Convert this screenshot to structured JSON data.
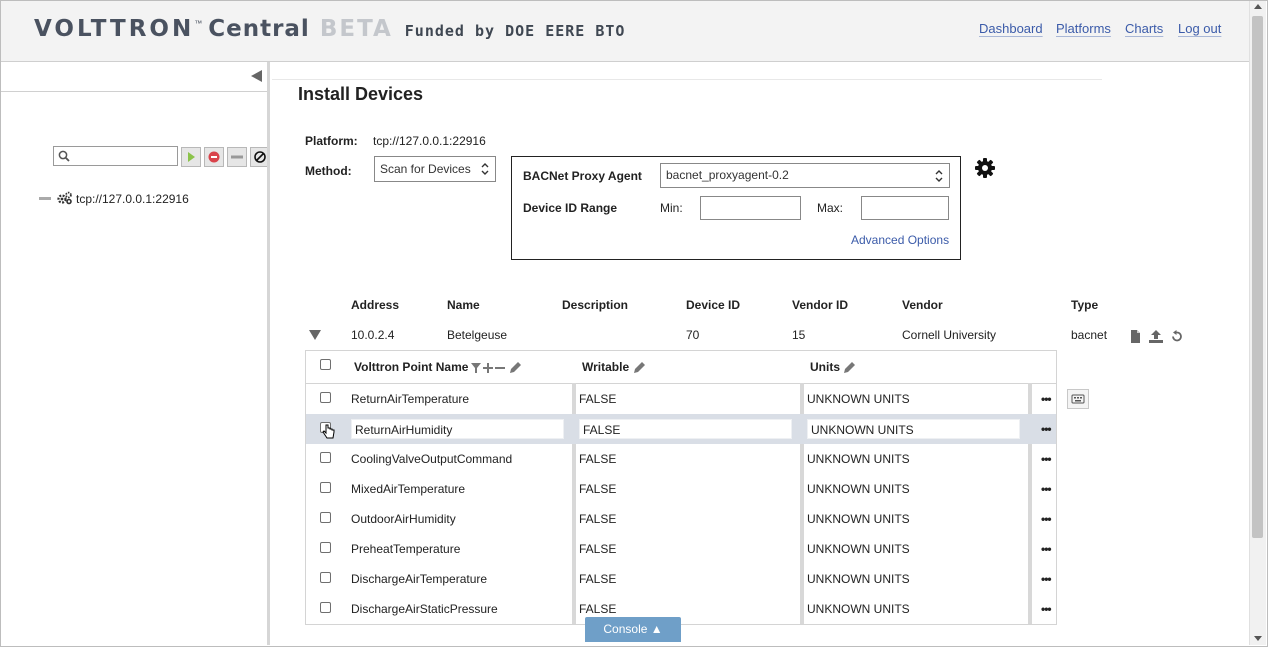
{
  "header": {
    "logo_volttron": "VOLTTRON",
    "logo_tm": "™",
    "logo_central": "Central",
    "logo_beta": "BETA",
    "logo_funded": "Funded by DOE EERE BTO",
    "nav": [
      "Dashboard",
      "Platforms",
      "Charts",
      "Log out"
    ]
  },
  "sidebar": {
    "search_placeholder": "",
    "platform_label": "tcp://127.0.0.1:22916"
  },
  "main": {
    "title": "Install Devices",
    "platform_label": "Platform:",
    "platform_value": "tcp://127.0.0.1:22916",
    "method_label": "Method:",
    "method_value": "Scan for Devices",
    "proxy_label": "BACNet Proxy Agent",
    "proxy_value": "bacnet_proxyagent-0.2",
    "range_label": "Device ID Range",
    "min_label": "Min:",
    "max_label": "Max:",
    "min_value": "",
    "max_value": "",
    "advanced_label": "Advanced Options"
  },
  "devices": {
    "columns": [
      "Address",
      "Name",
      "Description",
      "Device ID",
      "Vendor ID",
      "Vendor",
      "Type"
    ],
    "rows": [
      {
        "address": "10.0.2.4",
        "name": "Betelgeuse",
        "description": "",
        "device_id": "70",
        "vendor_id": "15",
        "vendor": "Cornell University",
        "type": "bacnet"
      }
    ]
  },
  "points": {
    "headers": {
      "name": "Volttron Point Name",
      "writable": "Writable",
      "units": "Units"
    },
    "rows": [
      {
        "name": "ReturnAirTemperature",
        "writable": "FALSE",
        "units": "UNKNOWN UNITS"
      },
      {
        "name": "ReturnAirHumidity",
        "writable": "FALSE",
        "units": "UNKNOWN UNITS"
      },
      {
        "name": "CoolingValveOutputCommand",
        "writable": "FALSE",
        "units": "UNKNOWN UNITS"
      },
      {
        "name": "MixedAirTemperature",
        "writable": "FALSE",
        "units": "UNKNOWN UNITS"
      },
      {
        "name": "OutdoorAirHumidity",
        "writable": "FALSE",
        "units": "UNKNOWN UNITS"
      },
      {
        "name": "PreheatTemperature",
        "writable": "FALSE",
        "units": "UNKNOWN UNITS"
      },
      {
        "name": "DischargeAirTemperature",
        "writable": "FALSE",
        "units": "UNKNOWN UNITS"
      },
      {
        "name": "DischargeAirStaticPressure",
        "writable": "FALSE",
        "units": "UNKNOWN UNITS"
      }
    ]
  },
  "console": {
    "label": "Console ▲"
  },
  "colors": {
    "link": "#3b5ba9",
    "console": "#6f9fc8",
    "selected_row": "#d9dee6"
  }
}
